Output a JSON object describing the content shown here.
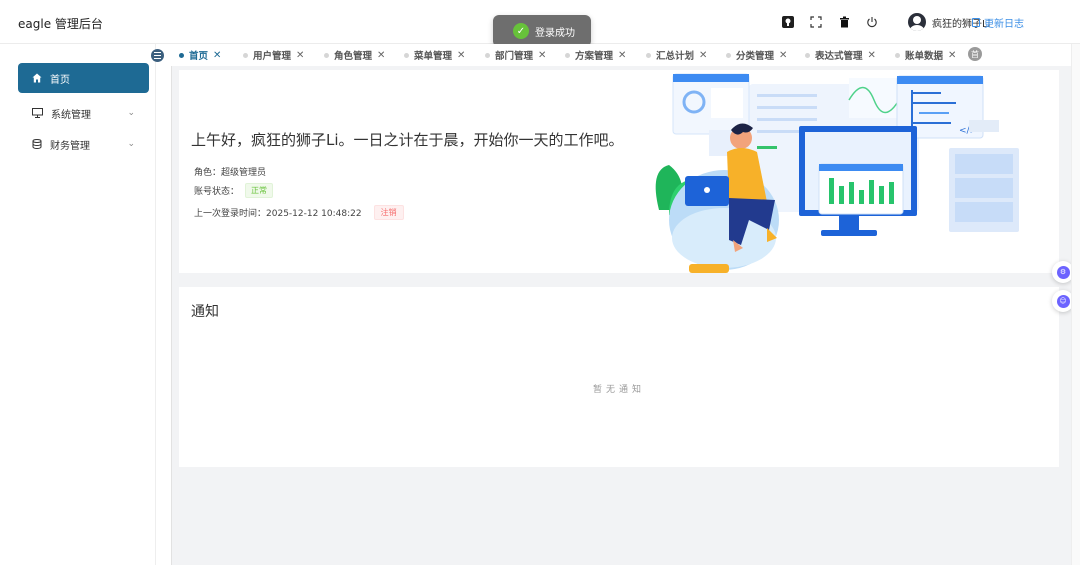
{
  "header": {
    "app_title": "eagle 管理后台",
    "username": "疯狂的狮子Li",
    "changelog_label": "更新日志",
    "icons": [
      "github-icon",
      "fullscreen-icon",
      "trash-icon",
      "power-icon"
    ]
  },
  "toast": {
    "message": "登录成功"
  },
  "sidebar": {
    "items": [
      {
        "label": "首页",
        "icon": "home-icon",
        "active": true
      },
      {
        "label": "系统管理",
        "icon": "monitor-icon",
        "expandable": true
      },
      {
        "label": "财务管理",
        "icon": "database-icon",
        "expandable": true
      }
    ]
  },
  "tabs": [
    {
      "label": "首页",
      "active": true
    },
    {
      "label": "用户管理"
    },
    {
      "label": "角色管理"
    },
    {
      "label": "菜单管理"
    },
    {
      "label": "部门管理"
    },
    {
      "label": "方案管理"
    },
    {
      "label": "汇总计划"
    },
    {
      "label": "分类管理"
    },
    {
      "label": "表达式管理"
    },
    {
      "label": "账单数据"
    }
  ],
  "tabs_more_label": "首",
  "welcome": {
    "greeting": "上午好，疯狂的狮子Li。一日之计在于晨，开始你一天的工作吧。",
    "role_label": "角色：",
    "role_value": "超级管理员",
    "status_label": "账号状态：",
    "status_value": "正常",
    "last_login_label": "上一次登录时间：",
    "last_login_value": "2025-12-12 10:48:22",
    "logout_label": "注销"
  },
  "notice": {
    "title": "通知",
    "empty_text": "暂无通知"
  },
  "colors": {
    "primary": "#1e6a94",
    "success": "#67c23a",
    "danger": "#f56c6c",
    "link": "#3a8ee6"
  }
}
